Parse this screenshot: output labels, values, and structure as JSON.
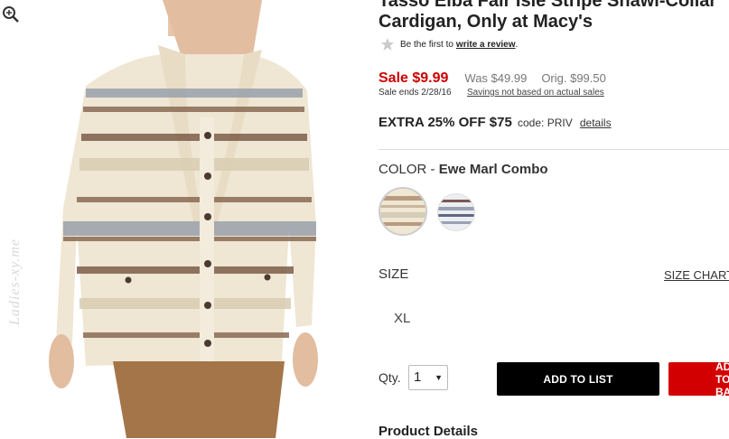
{
  "product": {
    "title_line1": "Tasso Elba Fair Isle Stripe Shawl-Collar",
    "title_line2": "Cardigan, Only at Macy's"
  },
  "rating": {
    "prefix": "Be the first to",
    "link": "write a review",
    "suffix": "."
  },
  "pricing": {
    "sale": "Sale $9.99",
    "was": "Was $49.99",
    "orig": "Orig. $99.50",
    "sale_ends": "Sale ends 2/28/16",
    "savings_note": "Savings not based on actual sales"
  },
  "promo": {
    "headline": "EXTRA 25% OFF $75",
    "code": "code: PRIV",
    "details": "details"
  },
  "color": {
    "label": "COLOR - ",
    "value": "Ewe Marl Combo"
  },
  "size": {
    "label": "SIZE",
    "chart_link": "SIZE CHART",
    "selected": "XL"
  },
  "purchase": {
    "qty_label": "Qty.",
    "qty_value": "1",
    "add_to_list": "ADD TO LIST",
    "add_to_bag": "ADD TO BAG"
  },
  "sections": {
    "product_details": "Product Details"
  },
  "image": {
    "watermark": "Ladies-xy.me"
  },
  "colors": {
    "sale_red": "#cc0000",
    "bag_red": "#d20000",
    "button_black": "#000000"
  }
}
